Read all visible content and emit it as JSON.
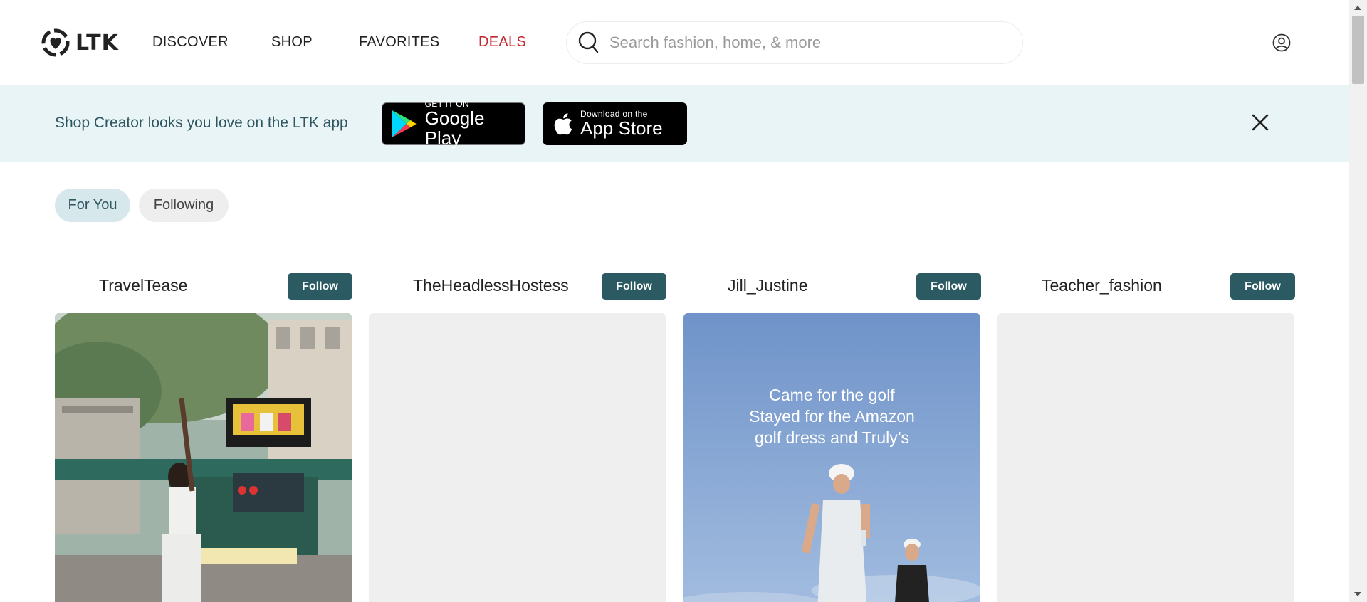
{
  "header": {
    "logo_text": "LTK",
    "nav": [
      {
        "label": "DISCOVER"
      },
      {
        "label": "SHOP"
      },
      {
        "label": "FAVORITES"
      },
      {
        "label": "DEALS",
        "color": "#c2272d"
      }
    ],
    "search": {
      "placeholder": "Search fashion, home, & more",
      "value": ""
    },
    "icons": {
      "search": "search-icon",
      "account": "account-icon"
    }
  },
  "banner": {
    "text": "Shop Creator looks you love on the LTK app",
    "google_play": {
      "small": "GET IT ON",
      "big": "Google Play"
    },
    "app_store": {
      "small": "Download on the",
      "big": "App Store"
    },
    "close_icon": "close-icon",
    "background": "#e9f4f6"
  },
  "feed_tabs": [
    {
      "label": "For You",
      "active": true
    },
    {
      "label": "Following",
      "active": false
    }
  ],
  "posts": [
    {
      "creator": "TravelTease",
      "follow_label": "Follow"
    },
    {
      "creator": "TheHeadlessHostess",
      "follow_label": "Follow"
    },
    {
      "creator": "Jill_Justine",
      "follow_label": "Follow",
      "overlay": [
        "Came for the golf",
        "Stayed for the Amazon",
        "golf dress and Truly’s"
      ]
    },
    {
      "creator": "Teacher_fashion",
      "follow_label": "Follow"
    }
  ],
  "colors": {
    "accent": "#2b5a62",
    "deals": "#c2272d",
    "placeholder_card": "#efefef"
  }
}
